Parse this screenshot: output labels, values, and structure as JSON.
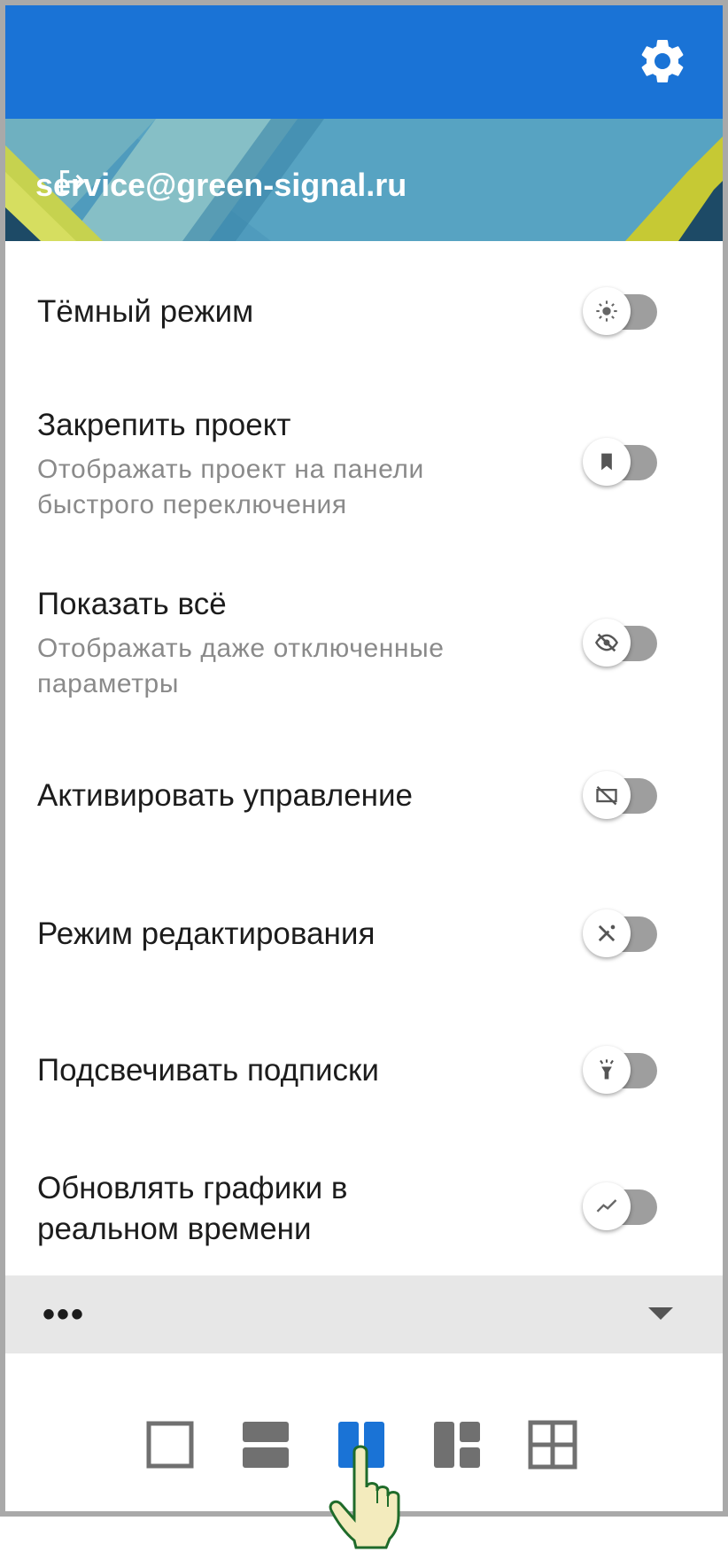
{
  "header": {
    "settings_icon": "gear-icon",
    "accent_color": "#1a73d6"
  },
  "account": {
    "email": "service@green-signal.ru",
    "logout_icon": "logout-icon"
  },
  "settings": [
    {
      "title": "Тёмный режим",
      "subtitle": "",
      "icon": "sun-icon",
      "enabled": false
    },
    {
      "title": "Закрепить проект",
      "subtitle": "Отображать проект на панели быстрого переключения",
      "icon": "bookmark-icon",
      "enabled": false
    },
    {
      "title": "Показать всё",
      "subtitle": "Отображать даже отключенные параметры",
      "icon": "eye-off-icon",
      "enabled": false
    },
    {
      "title": "Активировать управление",
      "subtitle": "",
      "icon": "control-off-icon",
      "enabled": false
    },
    {
      "title": "Режим редактирования",
      "subtitle": "",
      "icon": "edit-off-icon",
      "enabled": false
    },
    {
      "title": "Подсвечивать подписки",
      "subtitle": "",
      "icon": "flashlight-icon",
      "enabled": false
    },
    {
      "title": "Обновлять графики в реальном времени",
      "subtitle": "",
      "icon": "trend-icon",
      "enabled": false
    }
  ],
  "more": {
    "label": "•••"
  },
  "layouts": {
    "options": [
      "single",
      "rows-2",
      "columns-2",
      "left-large-grid",
      "grid-4"
    ],
    "selected": "columns-2",
    "selected_color": "#1a73d6",
    "inactive_color": "#707070"
  }
}
